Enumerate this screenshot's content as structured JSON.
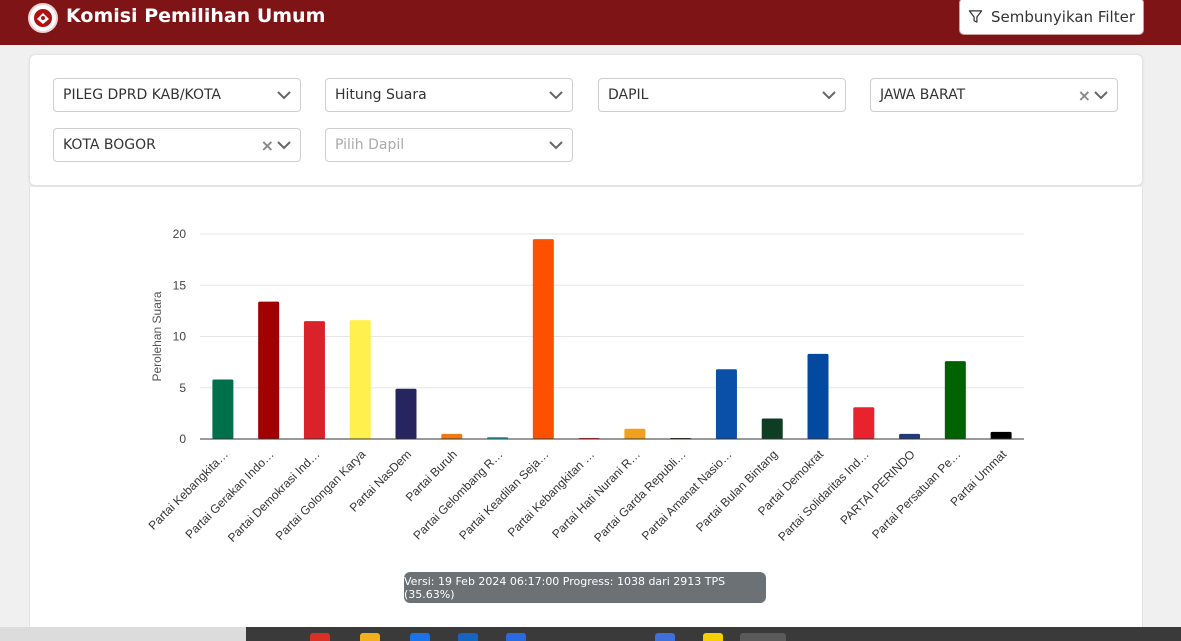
{
  "header": {
    "title": "Komisi Pemilihan Umum",
    "filter_button_label": "Sembunyikan Filter",
    "brand_color": "#7f1416"
  },
  "filters": {
    "election_type": "PILEG DPRD KAB/KOTA",
    "mode": "Hitung Suara",
    "level": "DAPIL",
    "province": "JAWA BARAT",
    "city": "KOTA BOGOR",
    "dapil_placeholder": "Pilih Dapil"
  },
  "chart_data": {
    "type": "bar",
    "ylabel": "Perolehan Suara",
    "ylim": [
      0,
      20
    ],
    "yticks": [
      0,
      5,
      10,
      15,
      20
    ],
    "grid": true,
    "categories": [
      "Partai Kebangkita…",
      "Partai Gerakan Indo…",
      "Partai Demokrasi Ind…",
      "Partai Golongan Karya",
      "Partai NasDem",
      "Partai Buruh",
      "Partai Gelombang R…",
      "Partai Keadilan Seja…",
      "Partai Kebangkitan …",
      "Partai Hati Nurani R…",
      "Partai Garda Republi…",
      "Partai Amanat Nasio…",
      "Partai Bulan Bintang",
      "Partai Demokrat",
      "Partai Solidaritas Ind…",
      "PARTAI PERINDO",
      "Partai Persatuan Pe…",
      "Partai Ummat"
    ],
    "values": [
      5.8,
      13.4,
      11.5,
      11.6,
      4.9,
      0.5,
      0.2,
      19.5,
      0.1,
      1.0,
      0.1,
      6.8,
      2.0,
      8.3,
      3.1,
      0.5,
      7.6,
      0.7
    ],
    "colors": [
      "#00704a",
      "#a00000",
      "#d9222a",
      "#fff04d",
      "#27255f",
      "#f07a11",
      "#18b7c9",
      "#ff5000",
      "#dd2020",
      "#f0a01c",
      "#1c2d1c",
      "#0a4fa8",
      "#0f3d24",
      "#0349a0",
      "#e8232d",
      "#233a7b",
      "#006300",
      "#000000"
    ]
  },
  "version_info": "Versi: 19 Feb 2024 06:17:00 Progress: 1038 dari 2913 TPS (35.63%)"
}
